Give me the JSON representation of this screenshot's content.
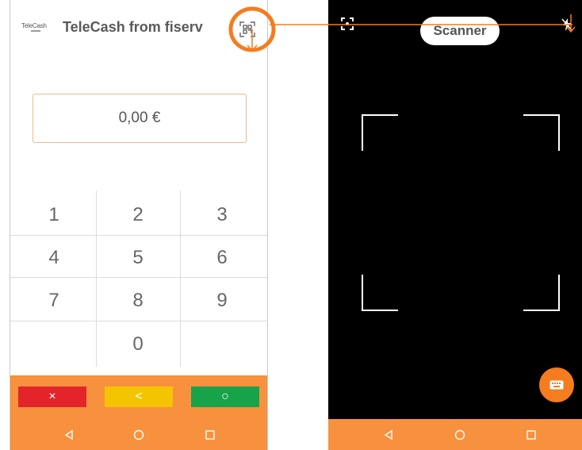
{
  "left_screen": {
    "logo_text": "TeleCash",
    "app_title": "TeleCash from fiserv",
    "amount": "0,00 €",
    "keypad": [
      "1",
      "2",
      "3",
      "4",
      "5",
      "6",
      "7",
      "8",
      "9",
      "0"
    ],
    "actions": {
      "cancel_symbol": "×",
      "back_symbol": "<",
      "confirm_symbol": "○",
      "cancel_color": "#e3242b",
      "back_color": "#f5c400",
      "confirm_color": "#16a34a"
    }
  },
  "right_screen": {
    "scanner_label": "Scanner"
  },
  "colors": {
    "accent": "#f7913d",
    "annotation": "#f57c1f"
  }
}
